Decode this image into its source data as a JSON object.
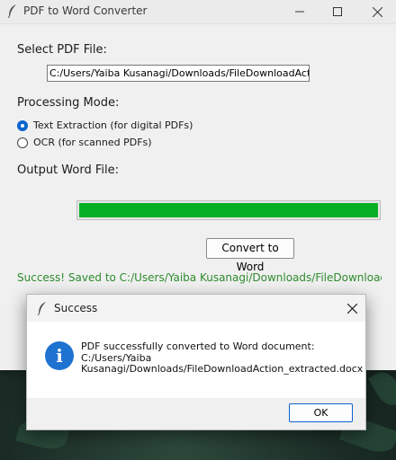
{
  "window": {
    "title": "PDF to Word Converter",
    "icon": "feather-icon"
  },
  "form": {
    "select_pdf_label": "Select PDF File:",
    "pdf_path": "C:/Users/Yaiba Kusanagi/Downloads/FileDownloadAction",
    "processing_mode_label": "Processing Mode:",
    "modes": [
      {
        "label": "Text Extraction (for digital PDFs)",
        "selected": true
      },
      {
        "label": "OCR (for scanned PDFs)",
        "selected": false
      }
    ],
    "output_label": "Output Word File:",
    "progress_percent": 100,
    "convert_button": "Convert to Word",
    "status_text": "Success! Saved to C:/Users/Yaiba Kusanagi/Downloads/FileDownloadAction_extracted.docx"
  },
  "dialog": {
    "title": "Success",
    "message_lines": [
      "PDF successfully converted to Word document:",
      "C:/Users/Yaiba",
      "Kusanagi/Downloads/FileDownloadAction_extracted.docx"
    ],
    "ok_button": "OK"
  },
  "colors": {
    "progress_fill": "#06b025",
    "status_text": "#2e8b2e",
    "info_icon": "#1e73d1",
    "radio_selected": "#0a64d0"
  }
}
